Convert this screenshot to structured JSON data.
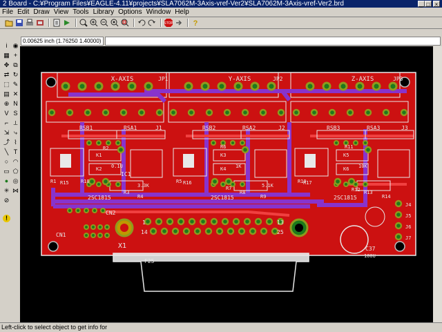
{
  "window": {
    "title": "2 Board - C:¥Program Files¥EAGLE-4.11¥projects¥SLA7062M-3Axis-vref-Ver2¥SLA7062M-3Axis-vref-Ver2.brd",
    "min_label": "_",
    "max_label": "□",
    "close_label": "×"
  },
  "menu": [
    "File",
    "Edit",
    "Draw",
    "View",
    "Tools",
    "Library",
    "Options",
    "Window",
    "Help"
  ],
  "coordinate_readout": "0.00625 inch (1.76250 1.40000)",
  "command_line": "",
  "status": "Left-click to select object to get info for",
  "toolbar_icons": [
    "open-icon",
    "save-icon",
    "print-icon",
    "cam-icon",
    "script-icon",
    "run-icon",
    "zoom-fit-icon",
    "zoom-in-icon",
    "zoom-out-icon",
    "zoom-redraw-icon",
    "zoom-select-icon",
    "undo-icon",
    "redo-icon",
    "stop-icon",
    "go-icon",
    "help-icon"
  ],
  "board": {
    "axis_labels": [
      "X-AXIS",
      "Y-AXIS",
      "Z-AXIS"
    ],
    "jp_labels": [
      "JP1",
      "JP2",
      "JP3"
    ],
    "j_labels": [
      "J1",
      "J2",
      "J3"
    ],
    "rsa_labels": [
      "RSA1",
      "RSA2",
      "RSA3"
    ],
    "rsb_labels": [
      "RSB1",
      "RSB2",
      "RSB3"
    ],
    "transistor_labels": [
      "2SC1815",
      "2SC1815",
      "2SC1815"
    ],
    "ic_label": "IC1",
    "connector_label": "F25",
    "cn2_label": "CN2",
    "cn1_label": "CN1",
    "x1_label": "X1",
    "pin1_label": "1",
    "pin13_label": "13",
    "pin14_label": "14",
    "pin25_label": "25",
    "cap_label": "C37",
    "cap_value": "100U",
    "side_labels": [
      "J4",
      "J5",
      "J6",
      "J7"
    ],
    "r_labels": [
      "R1",
      "R2",
      "R3",
      "R4",
      "R5",
      "R6",
      "R7",
      "R8",
      "R9",
      "R10",
      "R11",
      "R12",
      "R13",
      "R14",
      "R15",
      "R16",
      "R17",
      "R18"
    ],
    "k_labels": [
      "K1",
      "K2",
      "K3",
      "K4",
      "K5",
      "K6"
    ],
    "value_labels": [
      "0.1U",
      "1K",
      "10K",
      "3.3K",
      "5.1K"
    ]
  },
  "colors": {
    "canvas": "#000000",
    "board_fill": "#cc1111",
    "board_outline": "#e9e9e9",
    "pad_ring": "#8f9a1e",
    "pad_hole": "#1c7a1c",
    "bottom_trace": "#8833cc",
    "top_trace": "#dd3333",
    "silkscreen": "#e8e8e8",
    "title_bar": "#0a246a"
  }
}
